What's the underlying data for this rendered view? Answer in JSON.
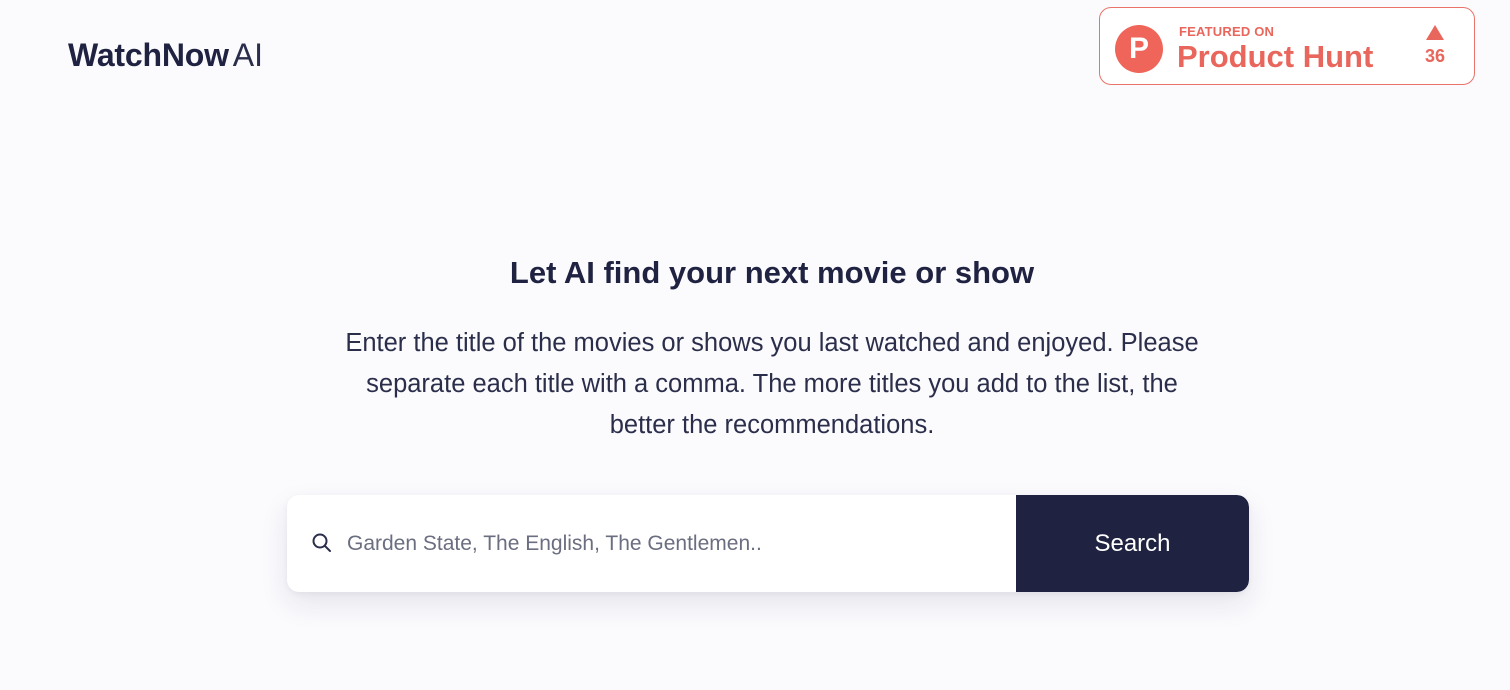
{
  "header": {
    "brand": "WatchNow",
    "brand_suffix": "AI"
  },
  "product_hunt": {
    "logo_letter": "P",
    "featured_label": "FEATURED ON",
    "name": "Product Hunt",
    "upvote_icon": "triangle-up-icon",
    "votes": "36",
    "accent_color": "#e9665c"
  },
  "hero": {
    "title": "Let AI find your next movie or show",
    "description": "Enter the title of the movies or shows you last watched and enjoyed. Please separate each title with a comma. The more titles you add to the list, the better the recommendations."
  },
  "search": {
    "icon": "search-icon",
    "placeholder": "Garden State, The English, The Gentlemen..",
    "value": "",
    "button_label": "Search",
    "button_color": "#1f2241"
  }
}
